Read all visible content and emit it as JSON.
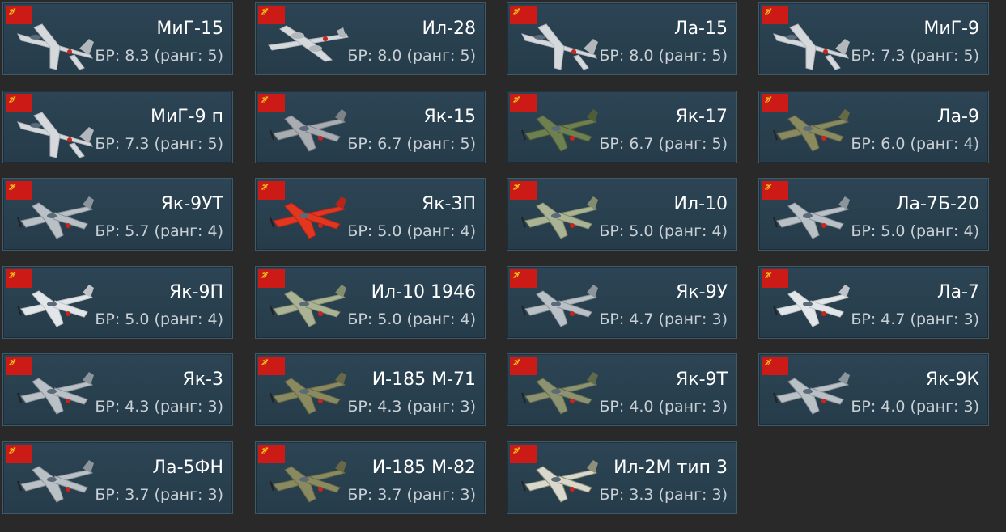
{
  "country_flag_icon": "ussr-flag-icon",
  "colors": {
    "page_background": "#292929",
    "card_background": "#2a4252",
    "card_border": "#3d5a6b",
    "flag_red": "#cc1a16",
    "name_text": "#ffffff",
    "br_text": "#c9d0d5"
  },
  "vehicles": [
    {
      "name": "МиГ-15",
      "br": "БР: 8.3 (ранг: 5)",
      "camo": "silver",
      "type": "jet"
    },
    {
      "name": "Ил-28",
      "br": "БР: 8.0 (ранг: 5)",
      "camo": "silver",
      "type": "bomber"
    },
    {
      "name": "Ла-15",
      "br": "БР: 8.0 (ранг: 5)",
      "camo": "silver",
      "type": "jet"
    },
    {
      "name": "МиГ-9",
      "br": "БР: 7.3 (ранг: 5)",
      "camo": "silver",
      "type": "jet"
    },
    {
      "name": "МиГ-9 п",
      "br": "БР: 7.3 (ранг: 5)",
      "camo": "silver",
      "type": "jet"
    },
    {
      "name": "Як-15",
      "br": "БР: 6.7 (ранг: 5)",
      "camo": "metal",
      "type": "prop"
    },
    {
      "name": "Як-17",
      "br": "БР: 6.7 (ранг: 5)",
      "camo": "green",
      "type": "prop"
    },
    {
      "name": "Ла-9",
      "br": "БР: 6.0 (ранг: 4)",
      "camo": "olive",
      "type": "prop"
    },
    {
      "name": "Як-9УТ",
      "br": "БР: 5.7 (ранг: 4)",
      "camo": "grey",
      "type": "prop"
    },
    {
      "name": "Як-3П",
      "br": "БР: 5.0 (ранг: 4)",
      "camo": "red",
      "type": "prop"
    },
    {
      "name": "Ил-10",
      "br": "БР: 5.0 (ранг: 4)",
      "camo": "sage",
      "type": "prop"
    },
    {
      "name": "Ла-7Б-20",
      "br": "БР: 5.0 (ранг: 4)",
      "camo": "grey",
      "type": "prop"
    },
    {
      "name": "Як-9П",
      "br": "БР: 5.0 (ранг: 4)",
      "camo": "white",
      "type": "prop"
    },
    {
      "name": "Ил-10 1946",
      "br": "БР: 5.0 (ранг: 4)",
      "camo": "sage",
      "type": "prop"
    },
    {
      "name": "Як-9У",
      "br": "БР: 4.7 (ранг: 3)",
      "camo": "grey",
      "type": "prop"
    },
    {
      "name": "Ла-7",
      "br": "БР: 4.7 (ранг: 3)",
      "camo": "white",
      "type": "prop"
    },
    {
      "name": "Як-3",
      "br": "БР: 4.3 (ранг: 3)",
      "camo": "grey",
      "type": "prop"
    },
    {
      "name": "И-185 М-71",
      "br": "БР: 4.3 (ранг: 3)",
      "camo": "olive",
      "type": "prop"
    },
    {
      "name": "Як-9Т",
      "br": "БР: 4.0 (ранг: 3)",
      "camo": "camo",
      "type": "prop"
    },
    {
      "name": "Як-9К",
      "br": "БР: 4.0 (ранг: 3)",
      "camo": "grey",
      "type": "prop"
    },
    {
      "name": "Ла-5ФН",
      "br": "БР: 3.7 (ранг: 3)",
      "camo": "grey",
      "type": "prop"
    },
    {
      "name": "И-185 М-82",
      "br": "БР: 3.7 (ранг: 3)",
      "camo": "olive",
      "type": "prop"
    },
    {
      "name": "Ил-2М тип 3",
      "br": "БР: 3.3 (ранг: 3)",
      "camo": "winter",
      "type": "prop"
    }
  ]
}
